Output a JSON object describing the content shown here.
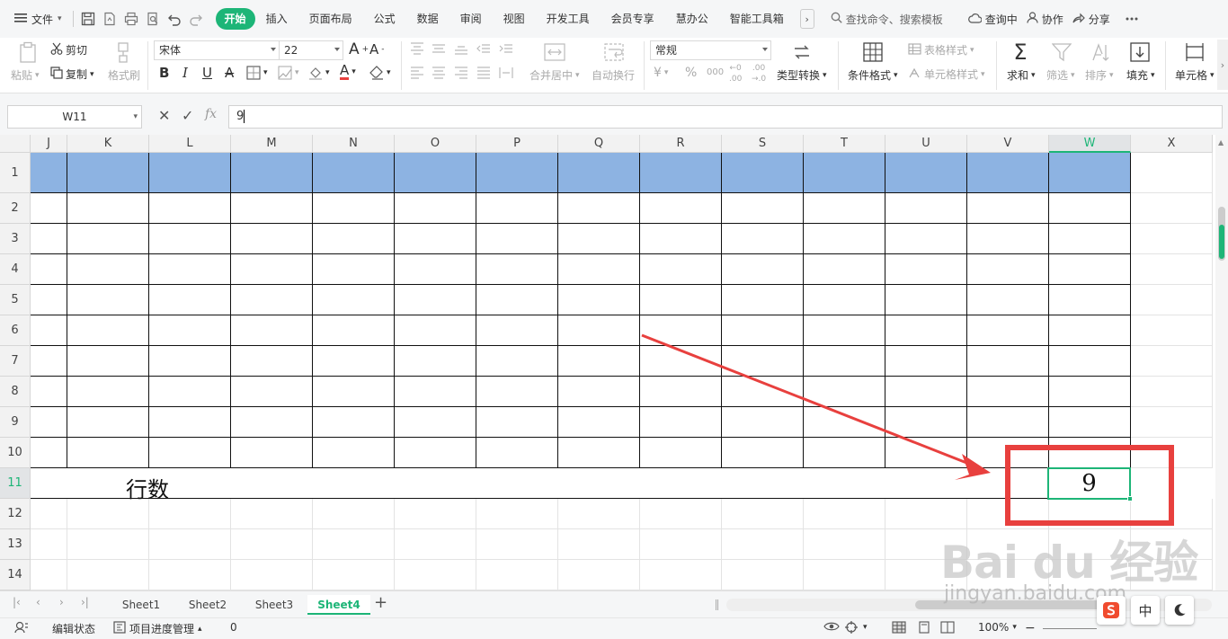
{
  "menubar": {
    "file_label": "文件",
    "tabs": [
      "开始",
      "插入",
      "页面布局",
      "公式",
      "数据",
      "审阅",
      "视图",
      "开发工具",
      "会员专享",
      "慧办公",
      "智能工具箱"
    ],
    "more": "›",
    "search_placeholder": "查找命令、搜索模板",
    "find_label": "查询中",
    "collab_label": "协作",
    "share_label": "分享"
  },
  "ribbon": {
    "cut": "剪切",
    "paste": "粘贴",
    "copy": "复制",
    "format_painter": "格式刷",
    "font_name": "宋体",
    "font_size": "22",
    "merge_center": "合并居中",
    "wrap_text": "自动换行",
    "number_format": "常规",
    "type_convert": "类型转换",
    "cond_format": "条件格式",
    "table_style": "表格样式",
    "cell_style": "单元格样式",
    "sum": "求和",
    "filter": "筛选",
    "sort": "排序",
    "fill": "填充",
    "cell": "单元格",
    "currency": "¥",
    "percent": "%",
    "thousands": "000"
  },
  "formula": {
    "name_box": "W11",
    "value": "9",
    "fx": "fx"
  },
  "grid": {
    "columns": [
      "J",
      "K",
      "L",
      "M",
      "N",
      "O",
      "P",
      "Q",
      "R",
      "S",
      "T",
      "U",
      "V",
      "W",
      "X"
    ],
    "rows": [
      "1",
      "2",
      "3",
      "4",
      "5",
      "6",
      "7",
      "8",
      "9",
      "10",
      "11",
      "12",
      "13",
      "14"
    ],
    "selected_column": "W",
    "selected_row": "11",
    "row11_label": "行数",
    "active_value": "9"
  },
  "sheets": {
    "tabs": [
      "Sheet1",
      "Sheet2",
      "Sheet3",
      "Sheet4"
    ],
    "active": "Sheet4"
  },
  "status": {
    "edit_state": "编辑状态",
    "project_mgmt": "项目进度管理",
    "count": "0",
    "zoom": "100%"
  },
  "watermark": {
    "brand": "Bai du 经验",
    "url": "jingyan.baidu.com"
  },
  "ime": {
    "mode": "中"
  },
  "colors": {
    "accent": "#1db577",
    "header_fill": "#8db3e2",
    "annotation_red": "#e8403e"
  }
}
